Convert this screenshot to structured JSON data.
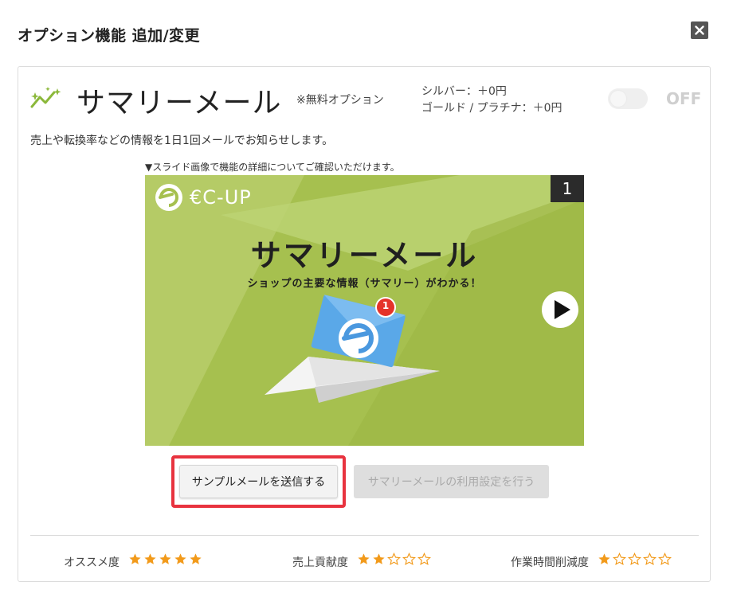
{
  "modal": {
    "title": "オプション機能 追加/変更",
    "close_icon": "close-icon"
  },
  "option": {
    "icon": "sparkle-trend-icon",
    "name": "サマリーメール",
    "free_note": "※無料オプション",
    "price_silver": "シルバー：＋0円",
    "price_gold": "ゴールド / プラチナ：＋0円",
    "toggle_state": "OFF",
    "description": "売上や転換率などの情報を1日1回メールでお知らせします。"
  },
  "slide": {
    "hint": "▼スライド画像で機能の詳細についてご確認いただけます。",
    "counter": "1",
    "logo_text": "€C-UP",
    "title": "サマリーメール",
    "subtitle": "ショップの主要な情報（サマリー）がわかる！",
    "badge": "1",
    "play_icon": "play-icon"
  },
  "buttons": {
    "sample_mail": "サンプルメールを送信する",
    "usage_settings": "サマリーメールの利用設定を行う"
  },
  "ratings": [
    {
      "label": "オススメ度",
      "stars": 5,
      "max": 5
    },
    {
      "label": "売上貢献度",
      "stars": 2,
      "max": 5
    },
    {
      "label": "作業時間削減度",
      "stars": 1,
      "max": 5
    }
  ],
  "colors": {
    "slide_bg": "#a6c04f",
    "star_filled": "#f29a1a",
    "star_empty": "#f29a1a",
    "highlight": "#e8333f",
    "icon_accent": "#8bb83a"
  }
}
